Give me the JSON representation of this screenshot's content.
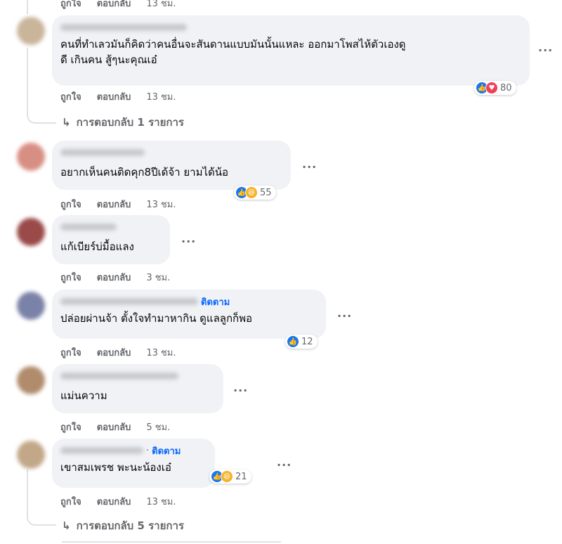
{
  "comments": [
    {
      "avatar_color": "#c9b59a",
      "text_lines": [
        "คนที่ทำเลวมันก็คิดว่าคนอื่นจะสันดานแบบมันนั้นแหละ ออกมาโพสไห้ตัวเองดู",
        "ดี เกินคน สู้ๆนะคุณเอ๋"
      ],
      "actions": {
        "like": "ถูกใจ",
        "reply": "ตอบกลับ",
        "time": "13 ชม."
      },
      "reactions": {
        "icons": [
          "like-icon",
          "love-icon"
        ],
        "count": "80"
      },
      "more": "···",
      "replies_label": "การตอบกลับ 1 รายการ"
    },
    {
      "avatar_color": "#d88f83",
      "text": "อยากเห็นคนติดคุก8ปีเด้จ้า ยามได้น้อ",
      "actions": {
        "like": "ถูกใจ",
        "reply": "ตอบกลับ",
        "time": "13 ชม."
      },
      "reactions": {
        "icons": [
          "like-icon",
          "haha-icon"
        ],
        "count": "55"
      },
      "more": "···"
    },
    {
      "avatar_color": "#9a4a48",
      "text": "แก้เบียร์บ่มื้อแลง",
      "actions": {
        "like": "ถูกใจ",
        "reply": "ตอบกลับ",
        "time": "3 ชม."
      },
      "more": "···"
    },
    {
      "avatar_color": "#7b82a8",
      "follow": "ติดตาม",
      "text": "ปล่อยผ่านจ้า ตั้งใจทำมาหากิน ดูแลลูกก็พอ",
      "actions": {
        "like": "ถูกใจ",
        "reply": "ตอบกลับ",
        "time": "13 ชม."
      },
      "reactions": {
        "icons": [
          "like-icon"
        ],
        "count": "12"
      },
      "more": "···"
    },
    {
      "avatar_color": "#b08c6c",
      "text": "แม่นความ",
      "actions": {
        "like": "ถูกใจ",
        "reply": "ตอบกลับ",
        "time": "5 ชม."
      },
      "more": "···"
    },
    {
      "avatar_color": "#c2a888",
      "separator": "·",
      "follow": "ติดตาม",
      "text": "เขาสมเพรช พะนะน้องเอ๋",
      "actions": {
        "like": "ถูกใจ",
        "reply": "ตอบกลับ",
        "time": "13 ชม."
      },
      "reactions": {
        "icons": [
          "like-icon",
          "haha-icon"
        ],
        "count": "21"
      },
      "more": "···",
      "replies_label": "การตอบกลับ 5 รายการ"
    }
  ],
  "top_partial": {
    "like": "ถูกใจ",
    "reply": "ตอบกลับ",
    "time": "13 ชม."
  }
}
